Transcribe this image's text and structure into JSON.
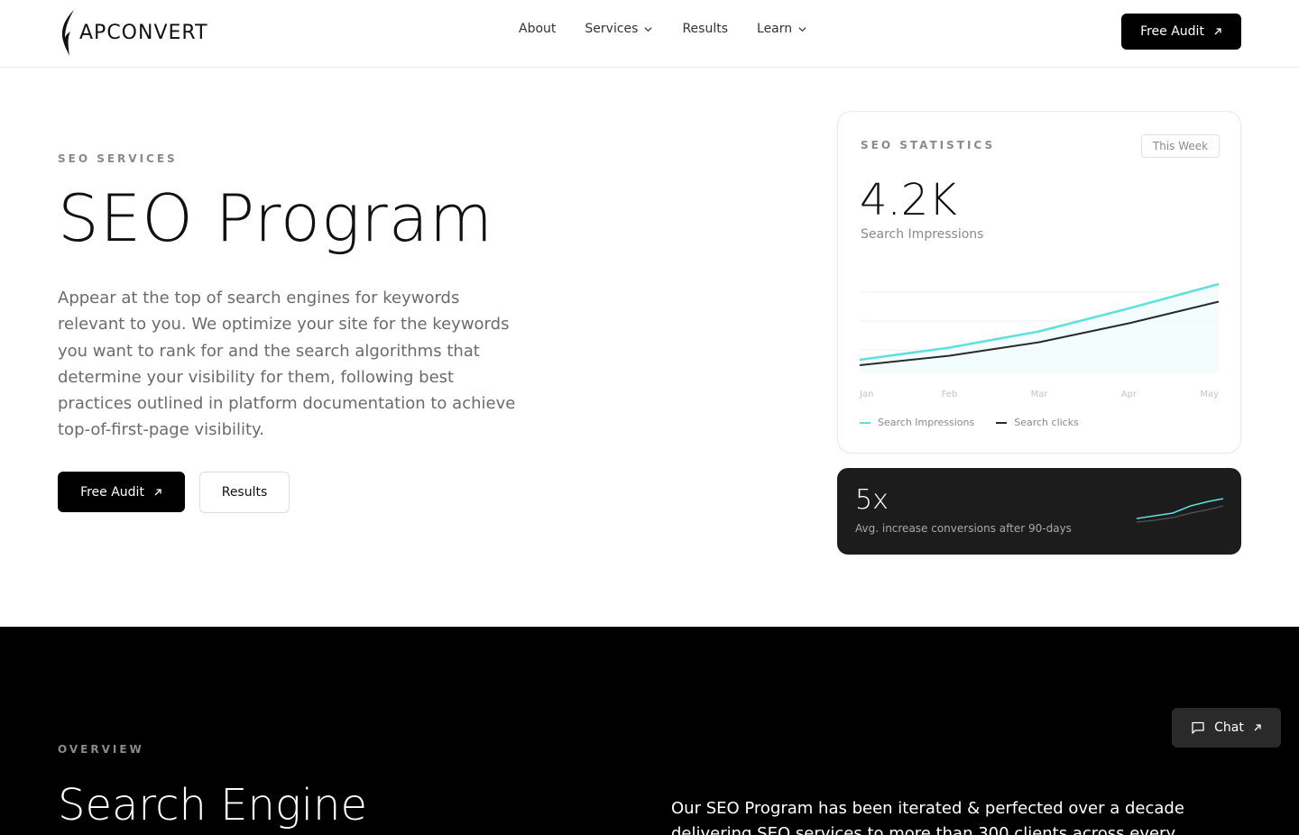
{
  "header": {
    "logo_text": "APCONVERT",
    "nav": [
      {
        "label": "About",
        "dropdown": false
      },
      {
        "label": "Services",
        "dropdown": true
      },
      {
        "label": "Results",
        "dropdown": false
      },
      {
        "label": "Learn",
        "dropdown": true
      }
    ],
    "cta_label": "Free Audit"
  },
  "hero": {
    "eyebrow": "SEO SERVICES",
    "title": "SEO Program",
    "description": "Appear at the top of search engines for keywords relevant to you. We optimize your site for the keywords you want to rank for and the search algorithms that determine your visibility for them, following best practices outlined in platform documentation to achieve top-of-first-page visibility.",
    "primary_button": "Free Audit",
    "secondary_button": "Results"
  },
  "stats_card": {
    "label": "SEO STATISTICS",
    "period_badge": "This Week",
    "value": "4.2K",
    "value_label": "Search Impressions"
  },
  "chart_data": {
    "type": "line",
    "x": [
      "Jan",
      "Feb",
      "Mar",
      "Apr",
      "May"
    ],
    "series": [
      {
        "name": "Search Impressions",
        "color": "#5ee0dc",
        "values": [
          10,
          19,
          31,
          48,
          66
        ]
      },
      {
        "name": "Search clicks",
        "color": "#2a2a2a",
        "values": [
          6,
          13,
          23,
          37,
          53
        ]
      }
    ],
    "ylim": [
      0,
      100
    ],
    "grid": true,
    "legend": "bottom-left"
  },
  "conversion_card": {
    "value": "5x",
    "label": "Avg. increase conversions after 90-days",
    "spark_colors": {
      "primary": "#5ee0dc",
      "secondary": "#555555"
    }
  },
  "overview": {
    "eyebrow": "OVERVIEW",
    "title": "Search Engine",
    "text": "Our SEO Program has been iterated & perfected over a decade delivering SEO services to more than 300 clients across every"
  },
  "chat": {
    "label": "Chat",
    "icon": "message-square-icon"
  }
}
